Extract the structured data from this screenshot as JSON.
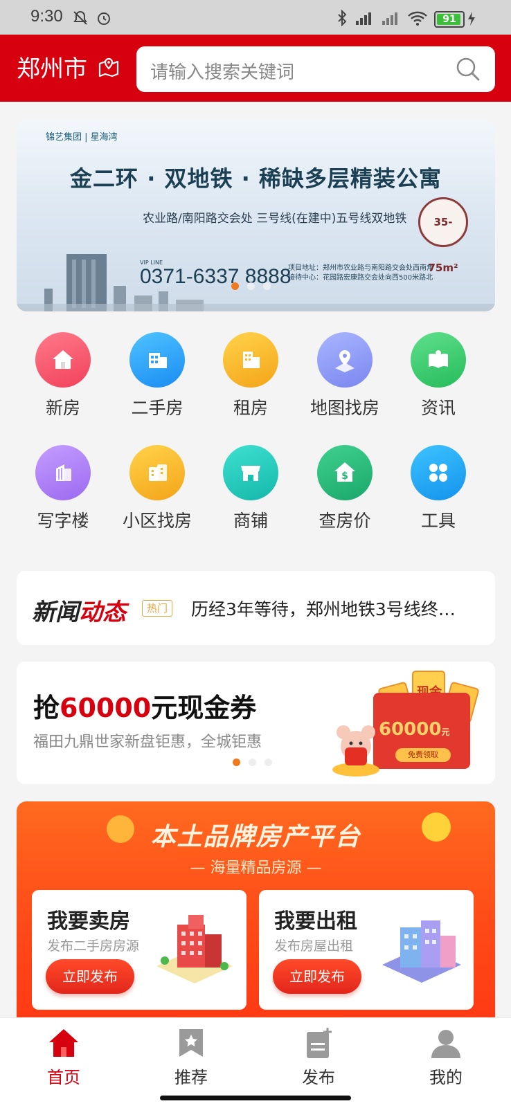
{
  "status_bar": {
    "time": "9:30",
    "battery": "91"
  },
  "header": {
    "city": "郑州市",
    "search_placeholder": "请输入搜索关键词"
  },
  "banner": {
    "logo_text": "锦艺集团 | 星海湾",
    "headline": "金二环 · 双地铁 · 稀缺多层精装公寓",
    "subline": "农业路/南阳路交会处  三号线(在建中)五号线双地铁",
    "phone_label": "VIP LINE",
    "phone": "0371-6337 8888",
    "address": [
      "项目地址：郑州市农业路与南阳路交会处西南角",
      "接待中心：花园路宏康路交会处向西500米路北"
    ],
    "badge": "35-75m²"
  },
  "grid": [
    {
      "label": "新房",
      "icon": "house-icon",
      "color": [
        "#ff7a8a",
        "#f1415b"
      ]
    },
    {
      "label": "二手房",
      "icon": "building-icon",
      "color": [
        "#4fc3ff",
        "#1a8cf2"
      ]
    },
    {
      "label": "租房",
      "icon": "apartment-icon",
      "color": [
        "#ffd34a",
        "#f4a418"
      ]
    },
    {
      "label": "地图找房",
      "icon": "map-pin-icon",
      "color": [
        "#a9b6ff",
        "#7a86ef"
      ]
    },
    {
      "label": "资讯",
      "icon": "book-icon",
      "color": [
        "#5fe08c",
        "#26bb5a"
      ]
    },
    {
      "label": "写字楼",
      "icon": "office-tower-icon",
      "color": [
        "#c49dff",
        "#9b6af0"
      ]
    },
    {
      "label": "小区找房",
      "icon": "community-icon",
      "color": [
        "#ffd34a",
        "#f4a418"
      ]
    },
    {
      "label": "商铺",
      "icon": "shop-icon",
      "color": [
        "#3ee0d0",
        "#14b8aa"
      ]
    },
    {
      "label": "查房价",
      "icon": "price-house-icon",
      "color": [
        "#3fd08e",
        "#1aa86a"
      ]
    },
    {
      "label": "工具",
      "icon": "tools-icon",
      "color": [
        "#3dc3ff",
        "#1493ec"
      ]
    }
  ],
  "news": {
    "brand_a": "新闻",
    "brand_b": "动态",
    "hot": "热门",
    "headline": "历经3年等待，郑州地铁3号线终…"
  },
  "promo": {
    "title_prefix": "抢",
    "title_amount": "60000",
    "title_suffix": "元现金券",
    "subtitle": "福田九鼎世家新盘钜惠，全城钜惠",
    "envelope_amount": "60000",
    "envelope_unit": "元",
    "envelope_button": "免费领取",
    "coupon_chars": [
      "现",
      "现金",
      "现"
    ]
  },
  "platform": {
    "title": "本土品牌房产平台",
    "subtitle": "— 海量精品房源 —",
    "cards": [
      {
        "title": "我要卖房",
        "subtitle": "发布二手房房源",
        "button": "立即发布"
      },
      {
        "title": "我要出租",
        "subtitle": "发布房屋出租",
        "button": "立即发布"
      }
    ]
  },
  "tabbar": [
    {
      "label": "首页",
      "icon": "home-icon",
      "active": true
    },
    {
      "label": "推荐",
      "icon": "bookmark-star-icon",
      "active": false
    },
    {
      "label": "发布",
      "icon": "publish-doc-icon",
      "active": false
    },
    {
      "label": "我的",
      "icon": "user-icon",
      "active": false
    }
  ]
}
